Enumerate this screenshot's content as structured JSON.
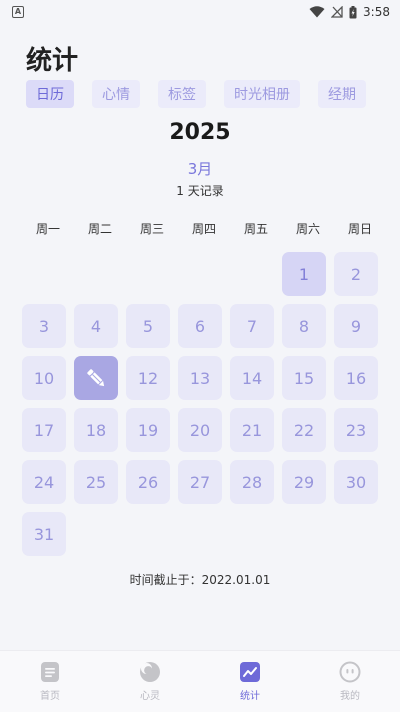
{
  "status_bar": {
    "app_icon_letter": "A",
    "time": "3:58"
  },
  "page_title": "统计",
  "tabs": [
    {
      "label": "日历",
      "active": true
    },
    {
      "label": "心情",
      "active": false
    },
    {
      "label": "标签",
      "active": false
    },
    {
      "label": "时光相册",
      "active": false
    },
    {
      "label": "经期",
      "active": false
    }
  ],
  "calendar": {
    "year": "2025",
    "month": "3月",
    "record_summary": "1 天记录",
    "weekdays": [
      "周一",
      "周二",
      "周三",
      "周四",
      "周五",
      "周六",
      "周日"
    ],
    "days": [
      "",
      "",
      "",
      "",
      "",
      "1",
      "2",
      "3",
      "4",
      "5",
      "6",
      "7",
      "8",
      "9",
      "10",
      "",
      "12",
      "13",
      "14",
      "15",
      "16",
      "17",
      "18",
      "19",
      "20",
      "21",
      "22",
      "23",
      "24",
      "25",
      "26",
      "27",
      "28",
      "29",
      "30",
      "31"
    ],
    "today": "1",
    "recorded_day": "11",
    "recorded_icon": "pen-icon"
  },
  "cutoff_text": "时间截止于：2022.01.01",
  "nav": [
    {
      "label": "首页",
      "icon": "document-icon",
      "active": false
    },
    {
      "label": "心灵",
      "icon": "moon-icon",
      "active": false
    },
    {
      "label": "统计",
      "icon": "chart-icon",
      "active": true
    },
    {
      "label": "我的",
      "icon": "profile-icon",
      "active": false
    }
  ],
  "colors": {
    "accent": "#6e6ad8",
    "cell": "#e8e8f8",
    "recorded_cell": "#a9a7e3"
  }
}
